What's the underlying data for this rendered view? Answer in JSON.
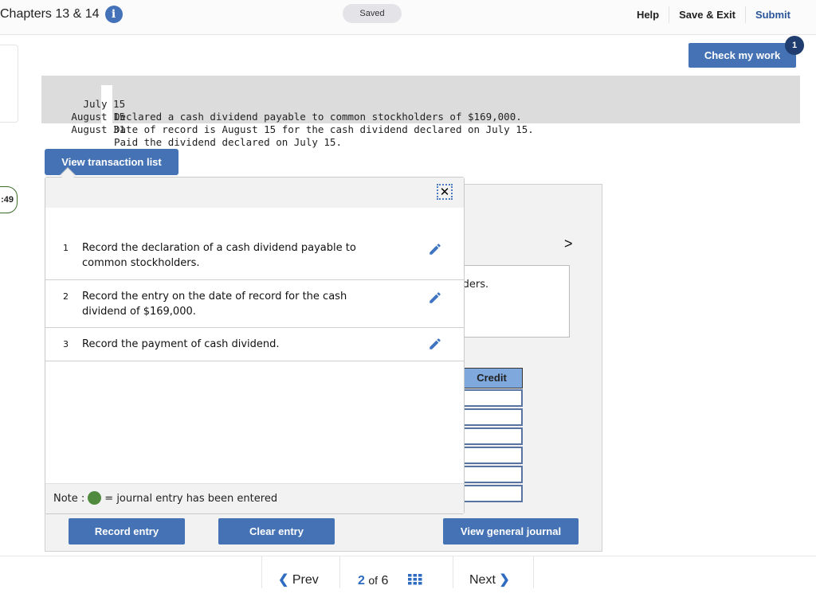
{
  "header": {
    "title": "Chapters 13 & 14",
    "status": "Saved",
    "links": [
      "Help",
      "Save & Exit",
      "Submit"
    ],
    "check_button": "Check my work",
    "check_badge": "1"
  },
  "timer": ":49",
  "problem": {
    "rows": [
      {
        "date": "July 15",
        "text": "Declared a cash dividend payable to common stockholders of $169,000."
      },
      {
        "date": "August 15",
        "text": "Date of record is August 15 for the cash dividend declared on July 15."
      },
      {
        "date": "August 31",
        "text": "Paid the dividend declared on July 15."
      }
    ]
  },
  "transaction_list": {
    "button": "View transaction list",
    "close_symbol": "✕",
    "items": [
      {
        "num": "1",
        "text": "Record the declaration of a cash dividend payable to common stockholders."
      },
      {
        "num": "2",
        "text": "Record the entry on the date of record for the cash dividend of $169,000."
      },
      {
        "num": "3",
        "text": "Record the payment of cash dividend."
      }
    ],
    "note_prefix": "Note :",
    "note_suffix": "= journal entry has been entered",
    "note_color": "#4f8a3e"
  },
  "journal": {
    "next_symbol": ">",
    "description_partial": "lders.",
    "credit_header": "Credit",
    "credit_values": [
      "",
      "",
      "",
      "",
      "",
      ""
    ]
  },
  "buttons": {
    "record": "Record entry",
    "clear": "Clear entry",
    "view_journal": "View general journal"
  },
  "pager": {
    "prev": "Prev",
    "current": "2",
    "of": "of",
    "total": "6",
    "next": "Next"
  },
  "colors": {
    "accent": "#4472b5",
    "badge": "#1f3d6e",
    "credit_header": "#7fa8dc"
  }
}
